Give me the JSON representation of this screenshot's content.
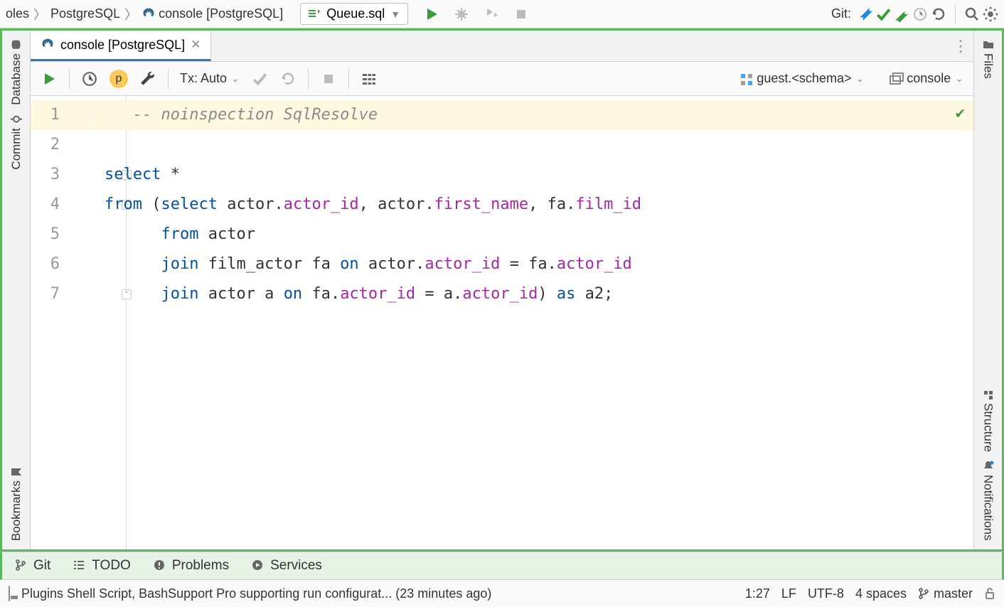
{
  "breadcrumb": {
    "items": [
      "oles",
      "PostgreSQL",
      "console [PostgreSQL]"
    ]
  },
  "run_config": {
    "label": "Queue.sql"
  },
  "git": {
    "label": "Git:"
  },
  "tabs": {
    "active": {
      "label": "console [PostgreSQL]"
    }
  },
  "editor_toolbar": {
    "p_badge": "p",
    "tx_label": "Tx: Auto",
    "schema_label": "guest.<schema>",
    "session_label": "console"
  },
  "code": {
    "lines": [
      {
        "num": "1",
        "tokens": [
          {
            "t": "   ",
            "cls": ""
          },
          {
            "t": "-- noinspection SqlResolve",
            "cls": "c"
          }
        ],
        "hl": true
      },
      {
        "num": "2",
        "tokens": [],
        "hl": false
      },
      {
        "num": "3",
        "tokens": [
          {
            "t": "select",
            "cls": "k"
          },
          {
            "t": " ",
            "cls": ""
          },
          {
            "t": "*",
            "cls": "op"
          }
        ],
        "hl": false,
        "fold": true
      },
      {
        "num": "4",
        "tokens": [
          {
            "t": "from",
            "cls": "k"
          },
          {
            "t": " (",
            "cls": "op"
          },
          {
            "t": "select",
            "cls": "k"
          },
          {
            "t": " actor",
            "cls": "i"
          },
          {
            "t": ".",
            "cls": "op"
          },
          {
            "t": "actor_id",
            "cls": "p"
          },
          {
            "t": ", actor",
            "cls": "i"
          },
          {
            "t": ".",
            "cls": "op"
          },
          {
            "t": "first_name",
            "cls": "p"
          },
          {
            "t": ", fa",
            "cls": "i"
          },
          {
            "t": ".",
            "cls": "op"
          },
          {
            "t": "film_id",
            "cls": "p"
          }
        ],
        "hl": false,
        "fold": true
      },
      {
        "num": "5",
        "tokens": [
          {
            "t": "      ",
            "cls": ""
          },
          {
            "t": "from",
            "cls": "k"
          },
          {
            "t": " actor",
            "cls": "i"
          }
        ],
        "hl": false
      },
      {
        "num": "6",
        "tokens": [
          {
            "t": "      ",
            "cls": ""
          },
          {
            "t": "join",
            "cls": "k"
          },
          {
            "t": " film_actor fa ",
            "cls": "i"
          },
          {
            "t": "on",
            "cls": "k"
          },
          {
            "t": " actor",
            "cls": "i"
          },
          {
            "t": ".",
            "cls": "op"
          },
          {
            "t": "actor_id",
            "cls": "p"
          },
          {
            "t": " = fa",
            "cls": "i"
          },
          {
            "t": ".",
            "cls": "op"
          },
          {
            "t": "actor_id",
            "cls": "p"
          }
        ],
        "hl": false
      },
      {
        "num": "7",
        "tokens": [
          {
            "t": "      ",
            "cls": ""
          },
          {
            "t": "join",
            "cls": "k"
          },
          {
            "t": " actor a ",
            "cls": "i"
          },
          {
            "t": "on",
            "cls": "k"
          },
          {
            "t": " fa",
            "cls": "i"
          },
          {
            "t": ".",
            "cls": "op"
          },
          {
            "t": "actor_id",
            "cls": "p"
          },
          {
            "t": " = a",
            "cls": "i"
          },
          {
            "t": ".",
            "cls": "op"
          },
          {
            "t": "actor_id",
            "cls": "p"
          },
          {
            "t": ") ",
            "cls": "op"
          },
          {
            "t": "as",
            "cls": "k"
          },
          {
            "t": " a2;",
            "cls": "i"
          }
        ],
        "hl": false,
        "foldend": true
      }
    ]
  },
  "left_tools": {
    "top": [
      "Database",
      "Commit"
    ],
    "bottom": [
      "Bookmarks"
    ]
  },
  "right_tools": {
    "top": [
      "Files"
    ],
    "bottom": [
      "Structure",
      "Notifications"
    ]
  },
  "bottom_tools": {
    "git": "Git",
    "todo": "TODO",
    "problems": "Problems",
    "services": "Services"
  },
  "status": {
    "message": "Plugins Shell Script, BashSupport Pro supporting run configurat... (23 minutes ago)",
    "pos": "1:27",
    "line_sep": "LF",
    "encoding": "UTF-8",
    "indent": "4 spaces",
    "branch": "master"
  }
}
